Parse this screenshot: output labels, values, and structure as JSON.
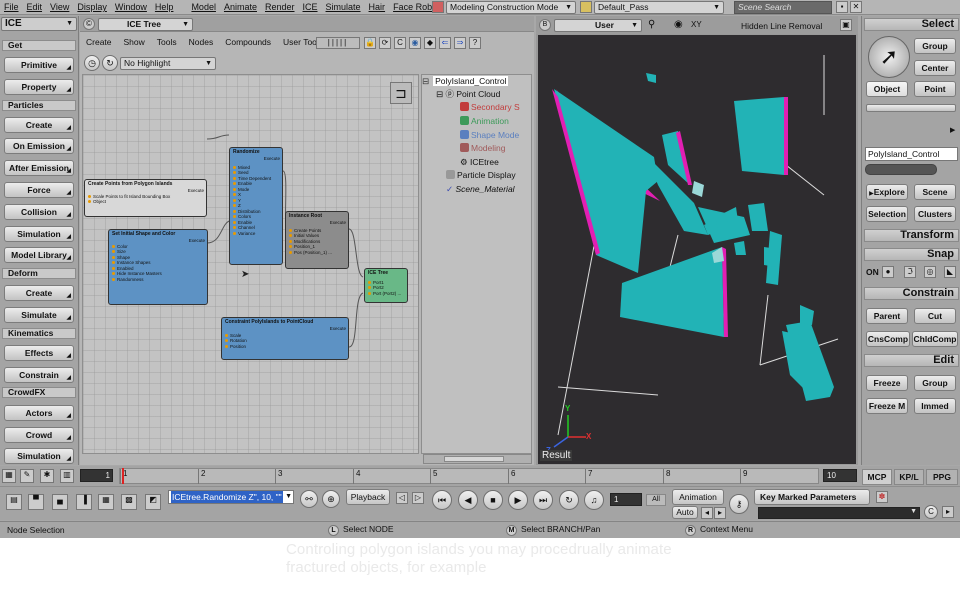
{
  "menu": {
    "items": [
      "File",
      "Edit",
      "View",
      "Display",
      "Window",
      "Help",
      "Model",
      "Animate",
      "Render",
      "ICE",
      "Simulate",
      "Hair",
      "Face Robot"
    ],
    "mode": "Modeling Construction Mode",
    "pass": "Default_Pass",
    "search_placeholder": "Scene Search"
  },
  "left_toolbar": {
    "title": "ICE",
    "sections": [
      {
        "title": "Get",
        "buttons": [
          "Primitive",
          "Property"
        ]
      },
      {
        "title": "Particles",
        "buttons": [
          "Create",
          "On Emission",
          "After Emission",
          "Force",
          "Collision",
          "Simulation",
          "Model Library"
        ]
      },
      {
        "title": "Deform",
        "buttons": [
          "Create",
          "Simulate"
        ]
      },
      {
        "title": "Kinematics",
        "buttons": [
          "Effects",
          "Constrain"
        ]
      },
      {
        "title": "CrowdFX",
        "buttons": [
          "Actors",
          "Crowd",
          "Simulation"
        ]
      }
    ]
  },
  "ice_tree": {
    "title": "ICE Tree",
    "menu": [
      "Create",
      "Show",
      "Tools",
      "Nodes",
      "Compounds",
      "User Tools"
    ],
    "highlight": "No Highlight",
    "nodes": {
      "create_points": {
        "title": "Create Points from Polygon Islands",
        "ports": [
          "Scale Points to fit Island Bounding Box",
          "Object"
        ],
        "out": "Execute"
      },
      "initial_shape": {
        "title": "Set Initial Shape and Color",
        "ports": [
          "Color",
          "Size",
          "Shape",
          "Instance Shapes",
          "Enabled",
          "Hide Instance Masters",
          "Randomness"
        ],
        "out": "Execute"
      },
      "randomize": {
        "title": "Randomize",
        "ports": [
          "Mixed",
          "Seed",
          "Time Dependent",
          "Enable",
          "Mode",
          "X",
          "Y",
          "Z",
          "Distribution",
          "Colors",
          "Enable",
          "Channel",
          "Variance"
        ],
        "out": "Execute"
      },
      "instance_root": {
        "title": "Instance Root",
        "ports": [
          "Create Points",
          "Initial Values",
          "Modifications",
          "Position_1",
          "Pos (Position_1) ..."
        ],
        "out": "Execute"
      },
      "constraint": {
        "title": "Constraint PolyIslands to PointCloud",
        "ports": [
          "Scale",
          "Rotation",
          "Position"
        ],
        "out": "Execute"
      },
      "ice_tree": {
        "title": "ICE Tree",
        "ports": [
          "Port1",
          "Port2",
          "Port (Port2) ..."
        ]
      }
    },
    "explorer": {
      "root": "PolyIsland_Control",
      "items": [
        {
          "label": "Point Cloud",
          "color": "#111111"
        },
        {
          "label": "Secondary S",
          "color": "#c23c3c"
        },
        {
          "label": "Animation",
          "color": "#3d9a5a"
        },
        {
          "label": "Shape Mode",
          "color": "#5a7fbf"
        },
        {
          "label": "Modeling",
          "color": "#a05a5a"
        },
        {
          "label": "ICEtree",
          "color": "#111111"
        },
        {
          "label": "Particle Display",
          "color": "#111111"
        },
        {
          "label": "Scene_Material",
          "color": "#111111"
        }
      ]
    }
  },
  "viewport": {
    "camera": "User",
    "mode": "Hidden Line Removal",
    "axes": {
      "x": "X",
      "y": "Y",
      "z": "Z"
    },
    "result_label": "Result",
    "colors": {
      "shard": "#22b3b6",
      "edge": "#e21fb3",
      "background": "#2e2c2f"
    }
  },
  "right_panel": {
    "select_title": "Select",
    "select_buttons": [
      "Group",
      "Center",
      "Object",
      "Point"
    ],
    "object_name": "PolyIsland_Control",
    "nav_buttons": [
      "Explore",
      "Scene",
      "Selection",
      "Clusters"
    ],
    "transform_title": "Transform",
    "snap_title": "Snap",
    "snap_on": "ON",
    "constrain_title": "Constrain",
    "constrain_buttons": [
      "Parent",
      "Cut",
      "CnsComp",
      "ChldComp"
    ],
    "edit_title": "Edit",
    "edit_buttons": [
      "Freeze",
      "Group",
      "Freeze M",
      "Immed"
    ]
  },
  "timeline": {
    "start_frame": "1",
    "ticks": [
      "1",
      "2",
      "3",
      "4",
      "5",
      "6",
      "7",
      "8",
      "9"
    ],
    "end_frame": "10"
  },
  "tabs": [
    "MCP",
    "KP/L",
    "PPG"
  ],
  "playback": {
    "expression": "ICEtree.Randomize Z\", 10, \"\"",
    "playback_label": "Playback",
    "frame": "1",
    "all_label": "All",
    "animation_label": "Animation",
    "auto_label": "Auto",
    "key_marked": "Key Marked Parameters"
  },
  "status": {
    "left": "Node Selection",
    "l_key": "L",
    "l_text": "Select NODE",
    "m_key": "M",
    "m_text": "Select BRANCH/Pan",
    "r_key": "R",
    "r_text": "Context Menu"
  },
  "caption": "Controling polygon islands you may procedrually animate fractured objects, for example"
}
